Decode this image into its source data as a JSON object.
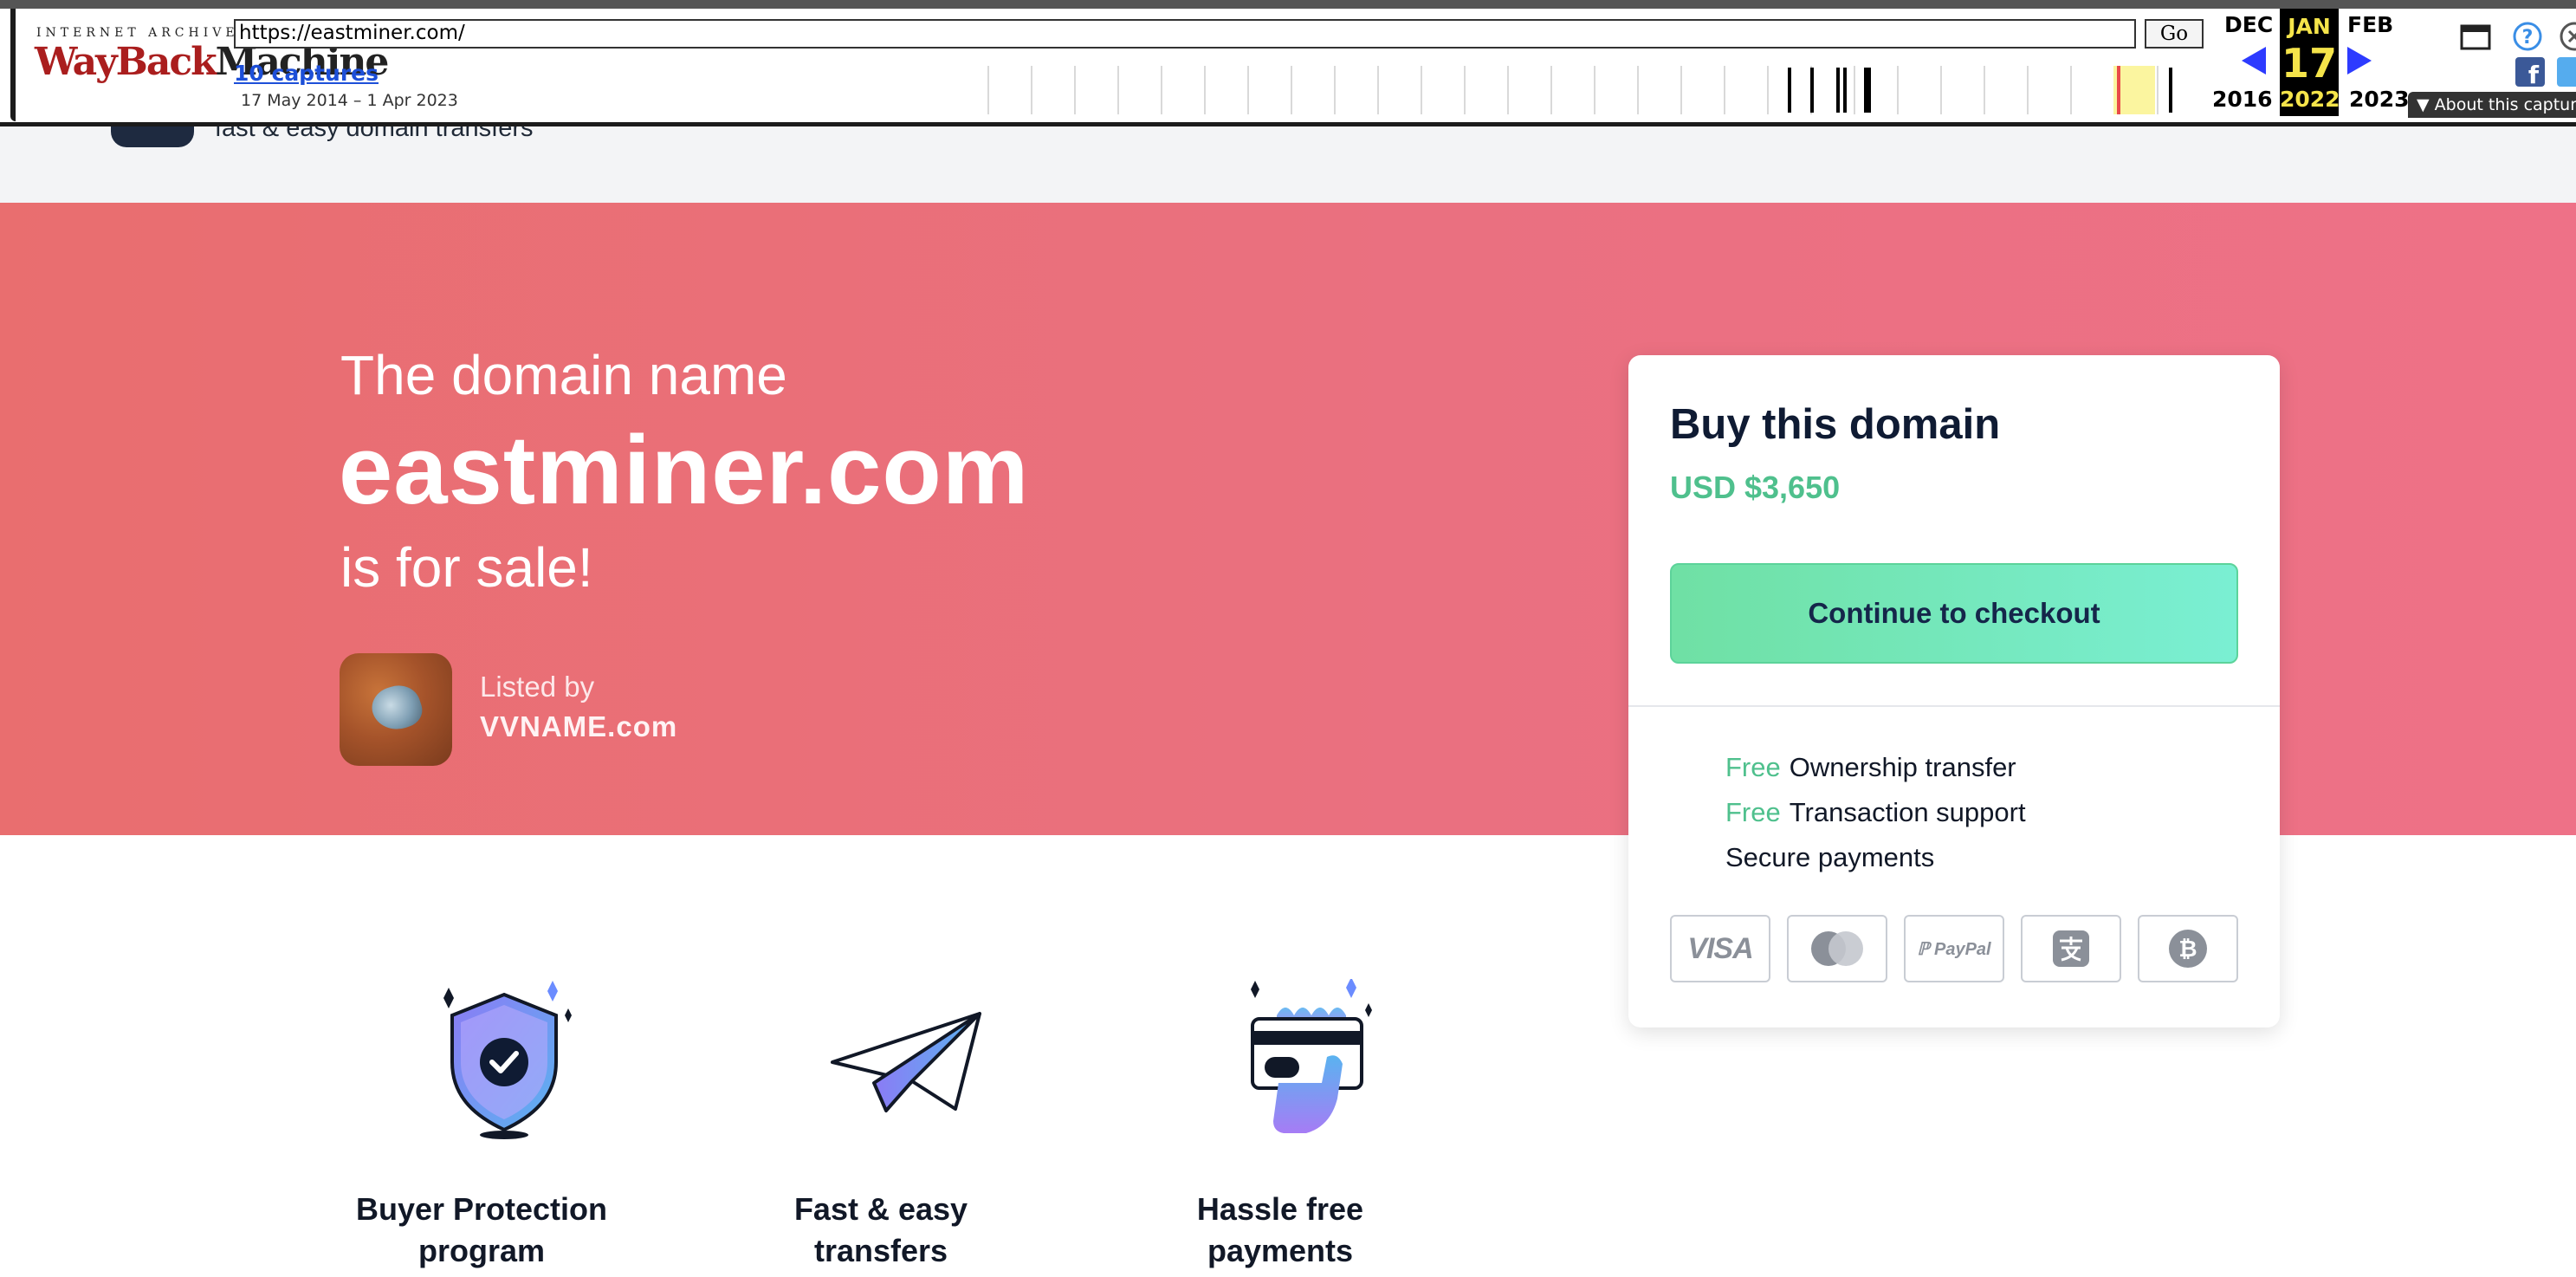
{
  "wayback": {
    "logo_top": "INTERNET ARCHIVE",
    "logo_way": "WayBack",
    "logo_machine": "Machine",
    "url": "https://eastminer.com/",
    "go_label": "Go",
    "captures": "10 captures",
    "range": "17 May 2014 – 1 Apr 2023",
    "prev_month": "DEC",
    "current_month": "JAN",
    "next_month": "FEB",
    "current_day": "17",
    "prev_year": "2016",
    "current_year": "2022",
    "next_year": "2023",
    "about": "About this captur"
  },
  "site": {
    "tagline": "fast & easy domain transfers"
  },
  "hero": {
    "pre": "The domain name",
    "domain": "eastminer.com",
    "post": "is for sale!",
    "listed_label": "Listed by",
    "listed_name": "VVNAME.com"
  },
  "card": {
    "title": "Buy this domain",
    "price": "USD $3,650",
    "checkout_label": "Continue to checkout",
    "features": [
      {
        "prefix": "Free",
        "text": "Ownership transfer"
      },
      {
        "prefix": "Free",
        "text": "Transaction support"
      },
      {
        "prefix": "",
        "text": "Secure payments"
      }
    ],
    "payment_methods": [
      "visa-icon",
      "mastercard-icon",
      "paypal-icon",
      "alipay-icon",
      "bitcoin-icon"
    ],
    "visa_label": "VISA",
    "paypal_label": "PayPal"
  },
  "features": [
    {
      "label": "Buyer Protection\nprogram",
      "icon": "shield-check-icon"
    },
    {
      "label": "Fast & easy\ntransfers",
      "icon": "paper-plane-icon"
    },
    {
      "label": "Hassle free\npayments",
      "icon": "card-hand-icon"
    }
  ],
  "colors": {
    "hero_start": "#e96e6f",
    "hero_end": "#ee7187",
    "accent_green": "#4fc08d",
    "navy": "#0f1b33"
  }
}
